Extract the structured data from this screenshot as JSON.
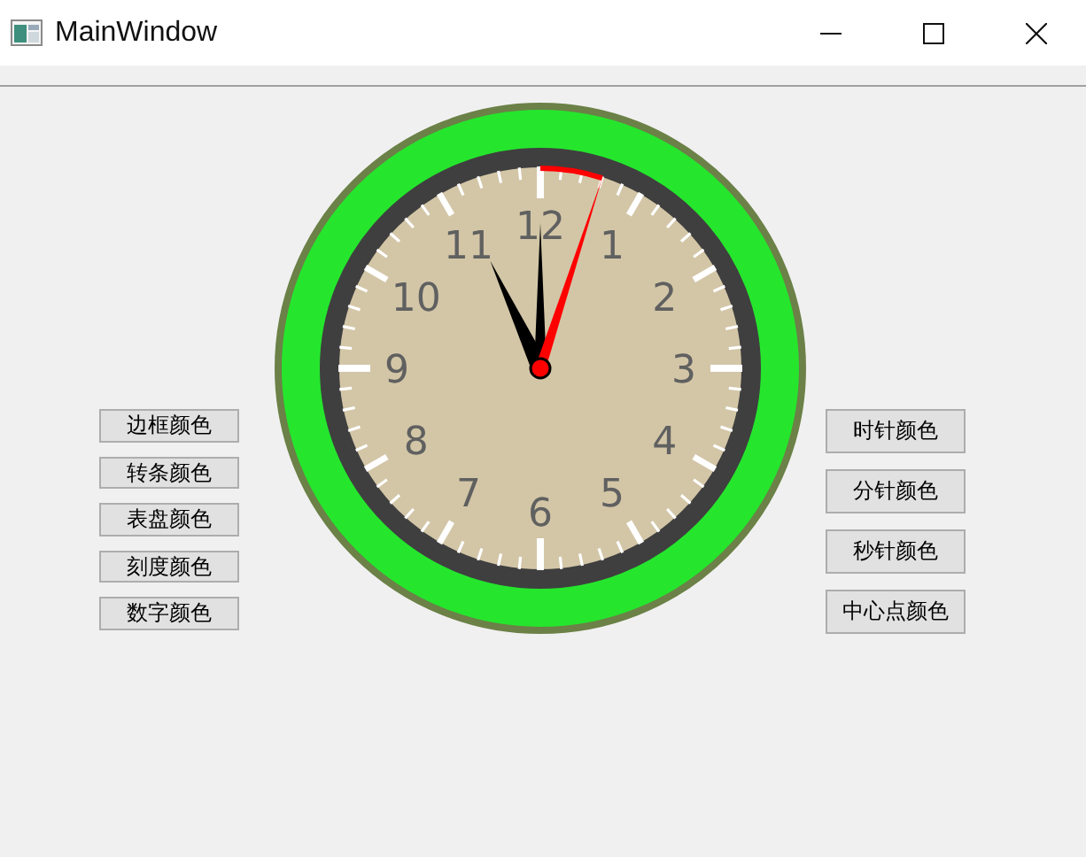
{
  "window": {
    "title": "MainWindow"
  },
  "clock": {
    "numbers": [
      "12",
      "1",
      "2",
      "3",
      "4",
      "5",
      "6",
      "7",
      "8",
      "9",
      "10",
      "11"
    ]
  },
  "left_buttons": [
    "边框颜色",
    "转条颜色",
    "表盘颜色",
    "刻度颜色",
    "数字颜色"
  ],
  "right_buttons": [
    "时针颜色",
    "分针颜色",
    "秒针颜色",
    "中心点颜色"
  ]
}
